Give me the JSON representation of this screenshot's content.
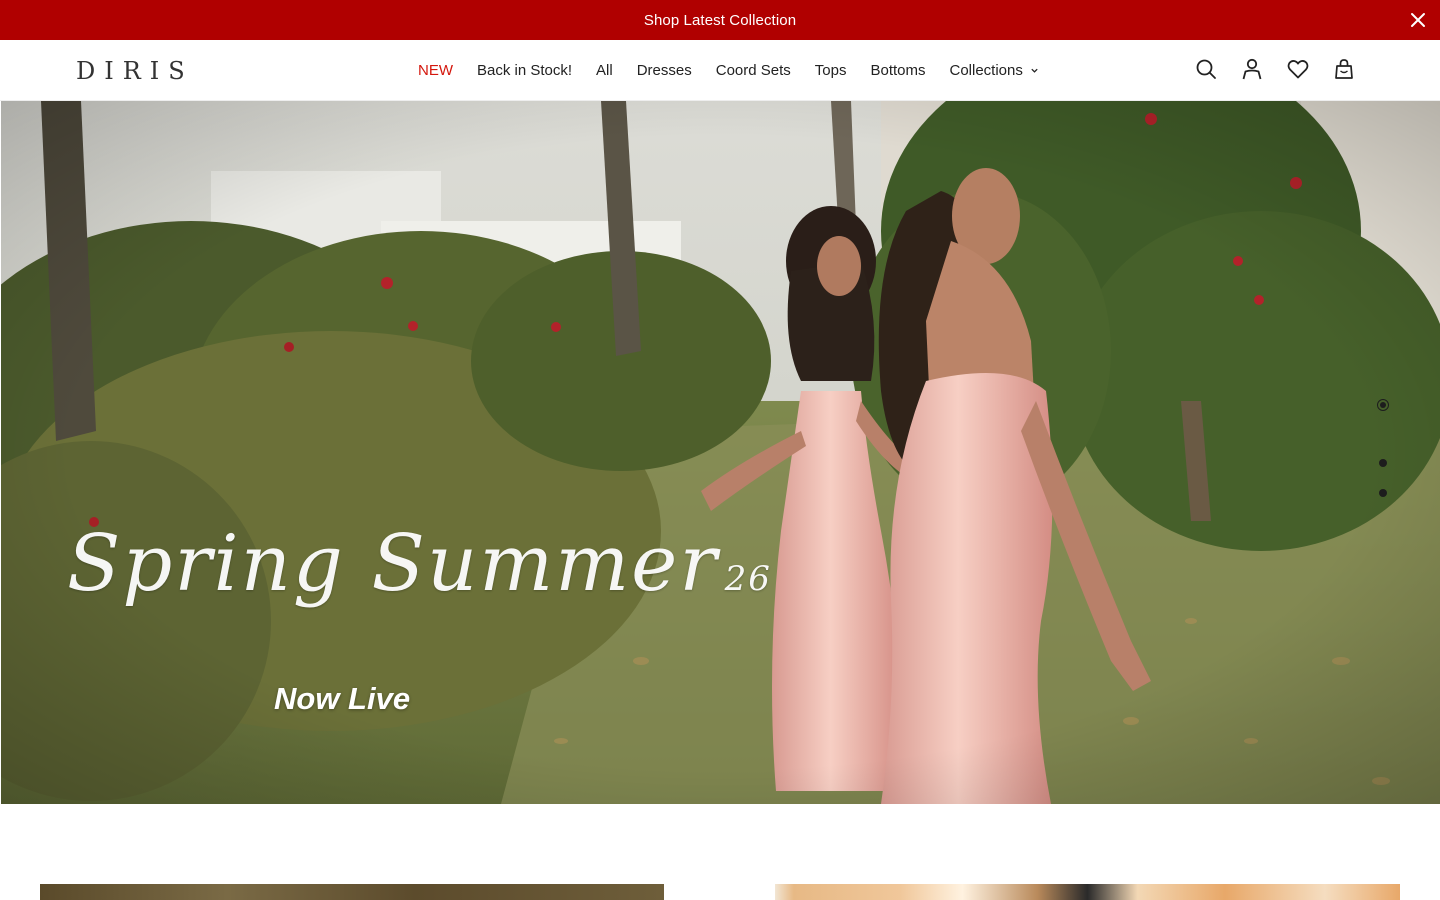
{
  "announcement": {
    "text": "Shop Latest Collection",
    "close_icon": "close-icon"
  },
  "header": {
    "logo": "DIRIS",
    "nav": [
      {
        "label": "NEW",
        "active": true
      },
      {
        "label": "Back in Stock!"
      },
      {
        "label": "All"
      },
      {
        "label": "Dresses"
      },
      {
        "label": "Coord Sets"
      },
      {
        "label": "Tops"
      },
      {
        "label": "Bottoms"
      },
      {
        "label": "Collections",
        "has_dropdown": true
      }
    ],
    "icons": [
      "search-icon",
      "account-icon",
      "wishlist-icon",
      "cart-icon"
    ]
  },
  "hero": {
    "headline_script": "Spring Summer",
    "headline_year": "26",
    "subline": "Now Live",
    "slides_total": 3,
    "active_slide": 1
  },
  "colors": {
    "announcement_bg": "#b00000",
    "nav_active": "#d4170d",
    "text": "#222222"
  }
}
